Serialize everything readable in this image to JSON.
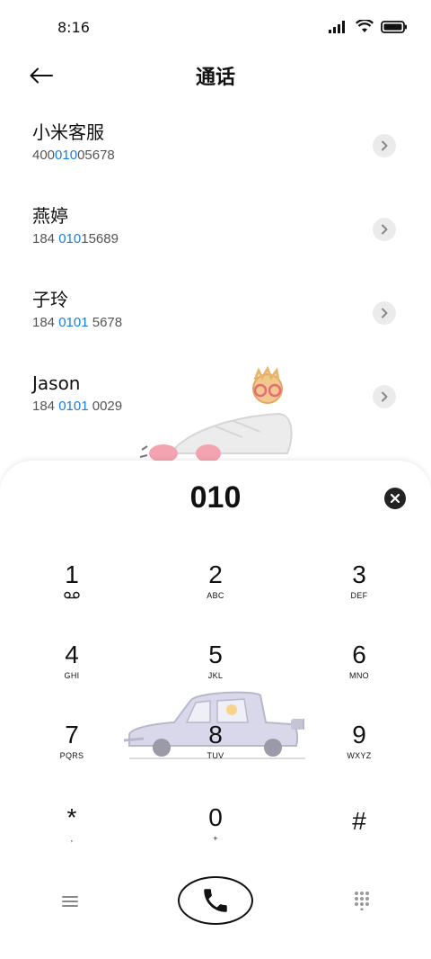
{
  "status": {
    "time": "8:16"
  },
  "header": {
    "title": "通话"
  },
  "results": [
    {
      "name": "小米客服",
      "number_pre": "400",
      "number_match": "010",
      "number_post": "05678"
    },
    {
      "name": "燕婷",
      "number_pre": "184 ",
      "number_match": "010",
      "number_post": "15689"
    },
    {
      "name": "子玲",
      "number_pre": "184 ",
      "number_match": "0101",
      "number_post": " 5678"
    },
    {
      "name": "Jason",
      "number_pre": "184 ",
      "number_match": "0101",
      "number_post": " 0029"
    }
  ],
  "dialer": {
    "input_value": "010",
    "keys": [
      {
        "digit": "1",
        "sub": "",
        "sub_icon": "voicemail-icon"
      },
      {
        "digit": "2",
        "sub": "ABC"
      },
      {
        "digit": "3",
        "sub": "DEF"
      },
      {
        "digit": "4",
        "sub": "GHI"
      },
      {
        "digit": "5",
        "sub": "JKL"
      },
      {
        "digit": "6",
        "sub": "MNO"
      },
      {
        "digit": "7",
        "sub": "PQRS"
      },
      {
        "digit": "8",
        "sub": "TUV"
      },
      {
        "digit": "9",
        "sub": "WXYZ"
      },
      {
        "digit": "*",
        "sub": ","
      },
      {
        "digit": "0",
        "sub": "+"
      },
      {
        "digit": "#",
        "sub": ""
      }
    ]
  },
  "colors": {
    "match_highlight": "#1a7fe0",
    "text": "#111111",
    "chevron_bg": "#ebebeb"
  },
  "icons": {
    "back": "arrow-left-icon",
    "chevron": "chevron-right-icon",
    "clear": "clear-circle-icon",
    "menu": "menu-icon",
    "call": "phone-icon",
    "keypad": "dialpad-icon"
  }
}
